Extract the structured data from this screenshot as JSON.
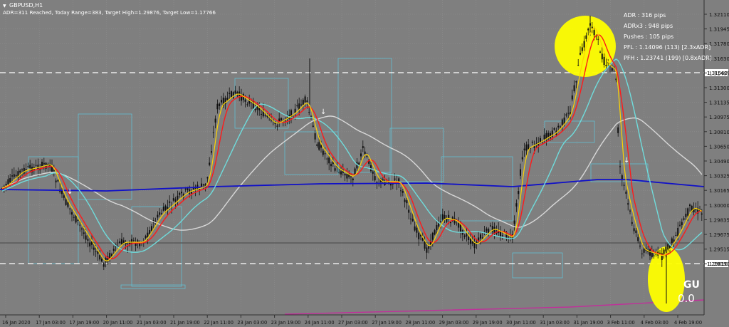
{
  "window": {
    "symbol_title": "GBPUSD,H1",
    "menu_arrow": "▼"
  },
  "info_line": "ADR=311 Reached, Today Range=383, Target High=1.29876, Target Low=1.17766",
  "stats": {
    "adr": "ADR : 316 pips",
    "adrx3": "ADRx3 : 948 pips",
    "pushes": "Pushes : 105 pips",
    "pfl": "PFL : 1.14096 (113) [2.3xADR]",
    "pfh": "PFH : 1.23741 (199) [0.8xADR]"
  },
  "annotation": {
    "label": "GU",
    "sublabel": "0.0"
  },
  "price_axis": {
    "ticks": [
      "1.32110",
      "1.31945",
      "1.31780",
      "1.31630",
      "1.31465",
      "1.31300",
      "1.31135",
      "1.30975",
      "1.30810",
      "1.30650",
      "1.30490",
      "1.30325",
      "1.30165",
      "1.30000",
      "1.29835",
      "1.29675",
      "1.29515",
      "1.29350"
    ],
    "highlight_upper": "1.31563",
    "highlight_lower": "1.29816"
  },
  "time_axis": {
    "labels": [
      "16 Jan 2020",
      "17 Jan 03:00",
      "17 Jan 19:00",
      "20 Jan 11:00",
      "21 Jan 03:00",
      "21 Jan 19:00",
      "22 Jan 11:00",
      "23 Jan 03:00",
      "23 Jan 19:00",
      "24 Jan 11:00",
      "27 Jan 03:00",
      "27 Jan 19:00",
      "28 Jan 11:00",
      "29 Jan 03:00",
      "29 Jan 19:00",
      "30 Jan 11:00",
      "31 Jan 03:00",
      "31 Jan 19:00",
      "3 Feb 11:00",
      "4 Feb 03:00",
      "4 Feb 19:00"
    ]
  },
  "colors": {
    "background": "#7f7f7f",
    "grid": "#8f8f8f",
    "candle": "#101010",
    "ma_fast": "#ffd400",
    "ma_red": "#ff1a1a",
    "ma_cyan": "#6fdcdc",
    "ma_white": "#d8d8d8",
    "ma_blue": "#1010c8",
    "magenta": "#c0309a",
    "boxes": "#5ec8dc",
    "yellow_highlight": "#ffff00",
    "dashed_level": "#ffffff"
  },
  "arrows": [
    "↓",
    "↓",
    "↓"
  ]
}
